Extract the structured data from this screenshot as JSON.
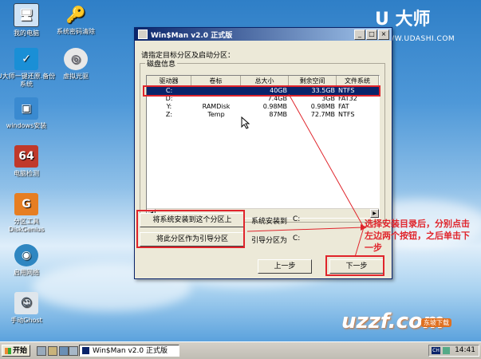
{
  "brand": {
    "name": "U 大师",
    "url": "WWW.UDASHI.COM"
  },
  "desktop_icons": [
    {
      "label": "我的电脑",
      "icon": "computer-icon"
    },
    {
      "label": "系统密码清除",
      "icon": "key-icon"
    },
    {
      "label": "U大师一键还原.备份系统",
      "icon": "bird-icon"
    },
    {
      "label": "虚拟光驱",
      "icon": "cdrom-icon"
    },
    {
      "label": "windows安装",
      "icon": "installer-icon"
    },
    {
      "label": "电脑检测",
      "icon": "64-icon"
    },
    {
      "label": "分区工具DiskGenius",
      "icon": "diskgenius-icon"
    },
    {
      "label": "启用网络",
      "icon": "network-globe-icon"
    },
    {
      "label": "手动Ghost",
      "icon": "ghost-icon"
    }
  ],
  "window": {
    "title": "Win$Man v2.0 正式版",
    "prompt": "请指定目标分区及启动分区：",
    "group_label": "磁盘信息",
    "columns": [
      "驱动器",
      "卷标",
      "总大小",
      "剩余空间",
      "文件系统"
    ],
    "rows": [
      {
        "drive": "C:",
        "label": "",
        "total": "40GB",
        "free": "33.5GB",
        "fs": "NTFS"
      },
      {
        "drive": "D:",
        "label": "",
        "total": "7.4GB",
        "free": "3GB",
        "fs": "FAT32"
      },
      {
        "drive": "Y:",
        "label": "RAMDisk",
        "total": "0.98MB",
        "free": "0.98MB",
        "fs": "FAT"
      },
      {
        "drive": "Z:",
        "label": "Temp",
        "total": "87MB",
        "free": "72.7MB",
        "fs": "NTFS"
      }
    ],
    "install_button": "将系统安装到这个分区上",
    "install_label": "系统安装到",
    "install_value": "C:",
    "boot_button": "将此分区作为引导分区",
    "boot_label": "引导分区为",
    "boot_value": "C:",
    "prev_button": "上一步",
    "next_button": "下一步",
    "min": "_",
    "max": "□",
    "close": "×"
  },
  "annotation": "选择安装目录后，分别点击左边两个按钮，之后单击下一步",
  "taskbar": {
    "start": "开始",
    "task": "Win$Man v2.0 正式版",
    "ime": "CH",
    "clock": "14:41"
  },
  "watermark": {
    "main": "uzzf.com",
    "sub": "东坡下载"
  },
  "colors": {
    "accent_red": "#e0242b",
    "titlebar": "#0a246a",
    "selection": "#0a246a"
  }
}
